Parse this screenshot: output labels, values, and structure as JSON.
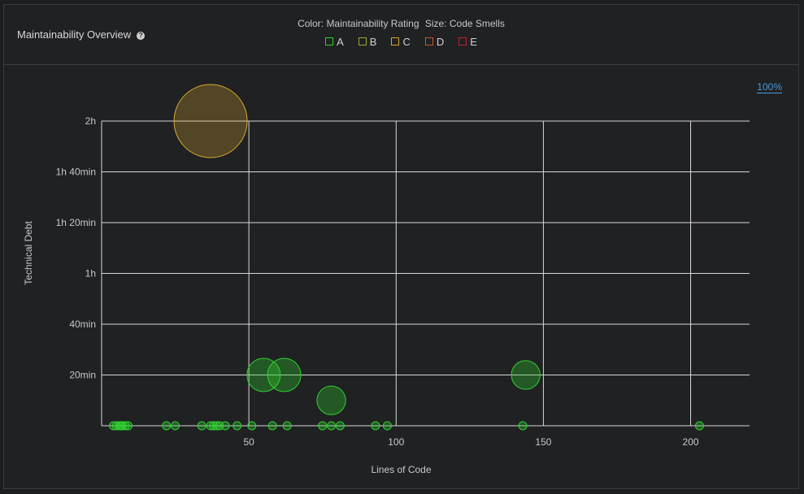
{
  "widget": {
    "title": "Maintainability Overview",
    "help_icon": "question-circle-icon",
    "zoom_label": "100%"
  },
  "legend": {
    "color_title": "Color: Maintainability Rating",
    "size_title": "Size: Code Smells",
    "items": [
      {
        "label": "A",
        "color": "#2fd12f"
      },
      {
        "label": "B",
        "color": "#9ea82c"
      },
      {
        "label": "C",
        "color": "#d4a82e"
      },
      {
        "label": "D",
        "color": "#c25a22"
      },
      {
        "label": "E",
        "color": "#c0222c"
      }
    ]
  },
  "chart_data": {
    "type": "scatter",
    "xlabel": "Lines of Code",
    "ylabel": "Technical Debt",
    "xlim": [
      0,
      220
    ],
    "ylim": [
      0,
      120
    ],
    "x_ticks": [
      {
        "value": 50,
        "label": "50"
      },
      {
        "value": 100,
        "label": "100"
      },
      {
        "value": 150,
        "label": "150"
      },
      {
        "value": 200,
        "label": "200"
      }
    ],
    "y_ticks": [
      {
        "value": 20,
        "label": "20min"
      },
      {
        "value": 40,
        "label": "40min"
      },
      {
        "value": 60,
        "label": "1h"
      },
      {
        "value": 80,
        "label": "1h 20min"
      },
      {
        "value": 100,
        "label": "1h 40min"
      },
      {
        "value": 120,
        "label": "2h"
      }
    ],
    "grid": true,
    "points": [
      {
        "x": 37,
        "y": 120,
        "rating": "C",
        "code_smells": 40
      },
      {
        "x": 55,
        "y": 20,
        "rating": "A",
        "code_smells": 6
      },
      {
        "x": 62,
        "y": 20,
        "rating": "A",
        "code_smells": 6
      },
      {
        "x": 78,
        "y": 10,
        "rating": "A",
        "code_smells": 4
      },
      {
        "x": 144,
        "y": 20,
        "rating": "A",
        "code_smells": 4
      },
      {
        "x": 4,
        "y": 0,
        "rating": "A",
        "code_smells": 0
      },
      {
        "x": 5,
        "y": 0,
        "rating": "A",
        "code_smells": 0
      },
      {
        "x": 6,
        "y": 0,
        "rating": "A",
        "code_smells": 0
      },
      {
        "x": 6.5,
        "y": 0,
        "rating": "A",
        "code_smells": 0
      },
      {
        "x": 7,
        "y": 0,
        "rating": "A",
        "code_smells": 0
      },
      {
        "x": 8,
        "y": 0,
        "rating": "A",
        "code_smells": 0
      },
      {
        "x": 9,
        "y": 0,
        "rating": "A",
        "code_smells": 0
      },
      {
        "x": 22,
        "y": 0,
        "rating": "A",
        "code_smells": 0
      },
      {
        "x": 25,
        "y": 0,
        "rating": "A",
        "code_smells": 0
      },
      {
        "x": 34,
        "y": 0,
        "rating": "A",
        "code_smells": 0
      },
      {
        "x": 37,
        "y": 0,
        "rating": "A",
        "code_smells": 0
      },
      {
        "x": 38,
        "y": 0,
        "rating": "A",
        "code_smells": 0
      },
      {
        "x": 39,
        "y": 0,
        "rating": "A",
        "code_smells": 0
      },
      {
        "x": 40,
        "y": 0,
        "rating": "A",
        "code_smells": 0
      },
      {
        "x": 42,
        "y": 0,
        "rating": "A",
        "code_smells": 0
      },
      {
        "x": 46,
        "y": 0,
        "rating": "A",
        "code_smells": 0
      },
      {
        "x": 51,
        "y": 0,
        "rating": "A",
        "code_smells": 0
      },
      {
        "x": 58,
        "y": 0,
        "rating": "A",
        "code_smells": 0
      },
      {
        "x": 63,
        "y": 0,
        "rating": "A",
        "code_smells": 0
      },
      {
        "x": 75,
        "y": 0,
        "rating": "A",
        "code_smells": 0
      },
      {
        "x": 78,
        "y": 0,
        "rating": "A",
        "code_smells": 0
      },
      {
        "x": 81,
        "y": 0,
        "rating": "A",
        "code_smells": 0
      },
      {
        "x": 93,
        "y": 0,
        "rating": "A",
        "code_smells": 0
      },
      {
        "x": 97,
        "y": 0,
        "rating": "A",
        "code_smells": 0
      },
      {
        "x": 143,
        "y": 0,
        "rating": "A",
        "code_smells": 0
      },
      {
        "x": 203,
        "y": 0,
        "rating": "A",
        "code_smells": 0
      }
    ]
  }
}
